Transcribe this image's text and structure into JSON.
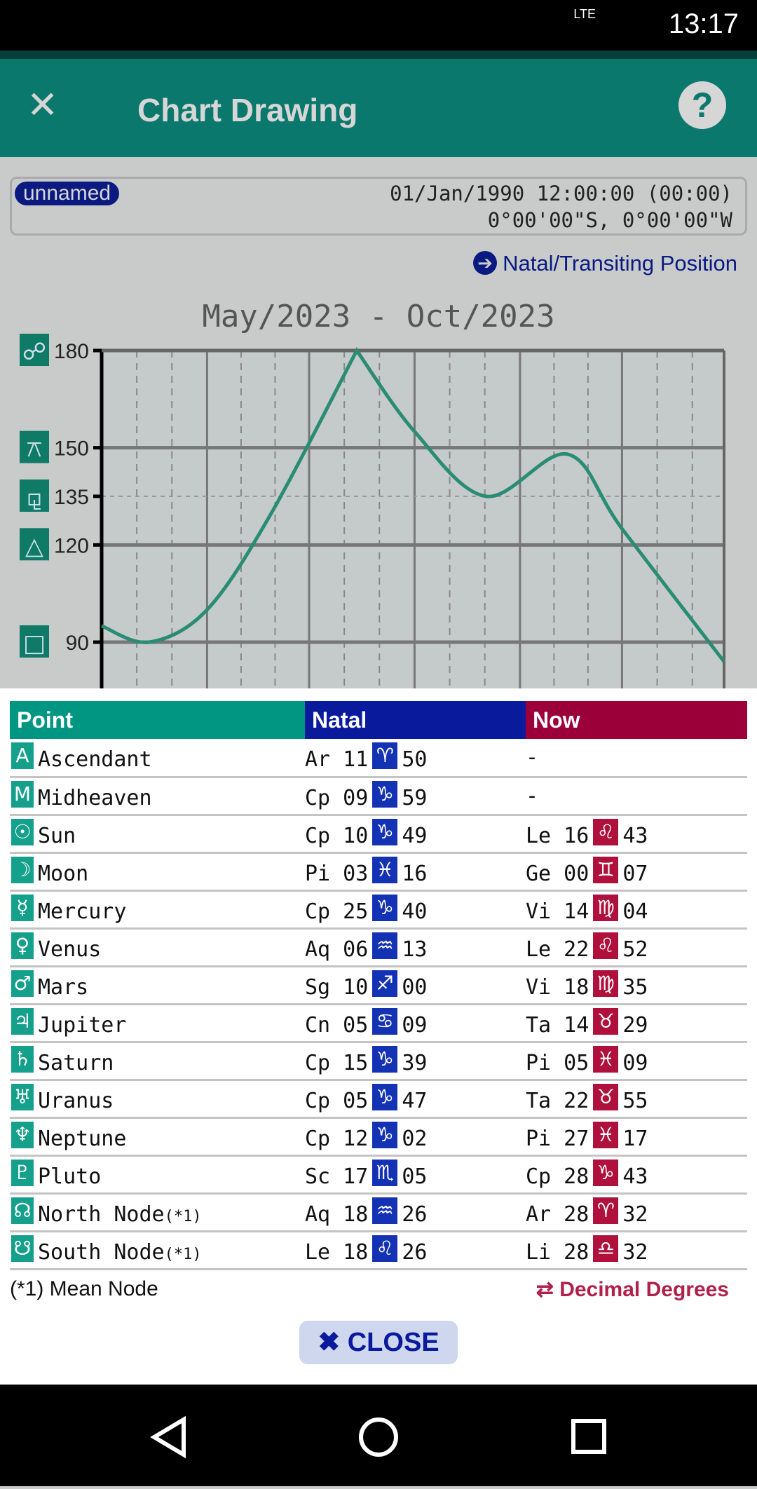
{
  "status": {
    "time": "13:17",
    "network": "LTE"
  },
  "appbar": {
    "title": "Chart Drawing",
    "close_icon": "close-icon",
    "help_icon": "help-icon"
  },
  "info": {
    "name": "unnamed",
    "datetime": "01/Jan/1990 12:00:00 (00:00)",
    "position": "0°00'00\"S, 0°00'00\"W"
  },
  "natal_link": "Natal/Transiting Position",
  "chart_data": {
    "type": "line",
    "title": "May/2023 - Oct/2023",
    "ylim": [
      80,
      180
    ],
    "yticks": [
      {
        "v": 180,
        "label": "180",
        "icon": "☍",
        "icon_name": "opposition-icon"
      },
      {
        "v": 150,
        "label": "150",
        "icon": "⚻",
        "icon_name": "quincunx-icon"
      },
      {
        "v": 135,
        "label": "135",
        "icon": "⚼",
        "icon_name": "sesquiquadrate-icon"
      },
      {
        "v": 120,
        "label": "120",
        "icon": "△",
        "icon_name": "trine-icon"
      },
      {
        "v": 90,
        "label": "90",
        "icon": "□",
        "icon_name": "square-icon"
      }
    ],
    "xrange": [
      "2023-05-01",
      "2023-10-31"
    ],
    "color": "#2a8c74",
    "points": [
      [
        "2023-05-01",
        95
      ],
      [
        "2023-05-15",
        90
      ],
      [
        "2023-06-01",
        100
      ],
      [
        "2023-06-20",
        130
      ],
      [
        "2023-07-15",
        180
      ],
      [
        "2023-08-01",
        155
      ],
      [
        "2023-08-22",
        135
      ],
      [
        "2023-09-15",
        148
      ],
      [
        "2023-10-01",
        125
      ],
      [
        "2023-10-31",
        84
      ]
    ]
  },
  "table": {
    "headers": {
      "point": "Point",
      "natal": "Natal",
      "now": "Now"
    },
    "rows": [
      {
        "g": "A",
        "point": "Ascendant",
        "n": [
          "Ar 11",
          "♈",
          "50"
        ],
        "w": [
          "-",
          "",
          ""
        ]
      },
      {
        "g": "M",
        "point": "Midheaven",
        "n": [
          "Cp 09",
          "♑",
          "59"
        ],
        "w": [
          "-",
          "",
          ""
        ]
      },
      {
        "g": "☉",
        "point": "Sun",
        "n": [
          "Cp 10",
          "♑",
          "49"
        ],
        "w": [
          "Le 16",
          "♌",
          "43"
        ]
      },
      {
        "g": "☽",
        "point": "Moon",
        "n": [
          "Pi 03",
          "♓",
          "16"
        ],
        "w": [
          "Ge 00",
          "♊",
          "07"
        ]
      },
      {
        "g": "☿",
        "point": "Mercury",
        "n": [
          "Cp 25",
          "♑",
          "40"
        ],
        "w": [
          "Vi 14",
          "♍",
          "04"
        ]
      },
      {
        "g": "♀",
        "point": "Venus",
        "n": [
          "Aq 06",
          "♒",
          "13"
        ],
        "w": [
          "Le 22",
          "♌",
          "52"
        ]
      },
      {
        "g": "♂",
        "point": "Mars",
        "n": [
          "Sg 10",
          "♐",
          "00"
        ],
        "w": [
          "Vi 18",
          "♍",
          "35"
        ]
      },
      {
        "g": "♃",
        "point": "Jupiter",
        "n": [
          "Cn 05",
          "♋",
          "09"
        ],
        "w": [
          "Ta 14",
          "♉",
          "29"
        ]
      },
      {
        "g": "♄",
        "point": "Saturn",
        "n": [
          "Cp 15",
          "♑",
          "39"
        ],
        "w": [
          "Pi 05",
          "♓",
          "09"
        ]
      },
      {
        "g": "♅",
        "point": "Uranus",
        "n": [
          "Cp 05",
          "♑",
          "47"
        ],
        "w": [
          "Ta 22",
          "♉",
          "55"
        ]
      },
      {
        "g": "♆",
        "point": "Neptune",
        "n": [
          "Cp 12",
          "♑",
          "02"
        ],
        "w": [
          "Pi 27",
          "♓",
          "17"
        ]
      },
      {
        "g": "♇",
        "point": "Pluto",
        "n": [
          "Sc 17",
          "♏",
          "05"
        ],
        "w": [
          "Cp 28",
          "♑",
          "43"
        ]
      },
      {
        "g": "☊",
        "point": "North Node",
        "note": "(*1)",
        "n": [
          "Aq 18",
          "♒",
          "26"
        ],
        "w": [
          "Ar 28",
          "♈",
          "32"
        ]
      },
      {
        "g": "☋",
        "point": "South Node",
        "note": "(*1)",
        "n": [
          "Le 18",
          "♌",
          "26"
        ],
        "w": [
          "Li 28",
          "♎",
          "32"
        ]
      }
    ]
  },
  "footer": {
    "note": "(*1) Mean Node",
    "decimal": "⇄ Decimal Degrees",
    "close": "✖ CLOSE"
  }
}
